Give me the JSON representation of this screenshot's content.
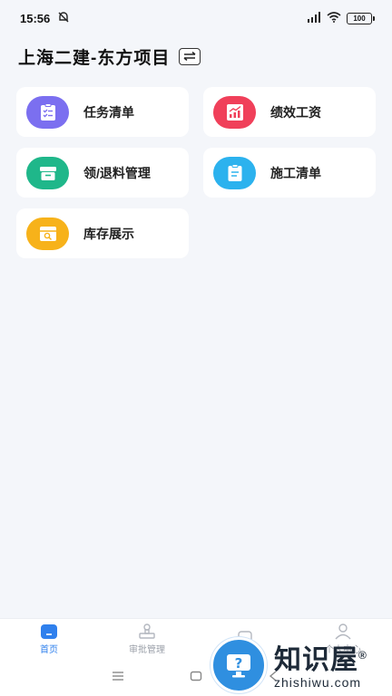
{
  "status_bar": {
    "time": "15:56",
    "battery": "100"
  },
  "header": {
    "project_title": "上海二建-东方项目"
  },
  "menu": [
    {
      "label": "任务清单",
      "icon": "task-list-icon",
      "color": "#7b6ff0"
    },
    {
      "label": "绩效工资",
      "icon": "performance-chart-icon",
      "color": "#f0405a"
    },
    {
      "label": "领/退料管理",
      "icon": "material-box-icon",
      "color": "#1fb78a"
    },
    {
      "label": "施工清单",
      "icon": "clipboard-icon",
      "color": "#2cb2ee"
    },
    {
      "label": "库存展示",
      "icon": "inventory-icon",
      "color": "#f7b21a"
    }
  ],
  "tabbar": [
    {
      "label": "首页",
      "active": true
    },
    {
      "label": "审批管理",
      "active": false
    },
    {
      "label": "",
      "active": false
    },
    {
      "label": "个人中心",
      "active": false
    }
  ],
  "watermark": {
    "main": "知识屋",
    "sub": "zhishiwu.com",
    "mark": "®"
  },
  "colors": {
    "accent": "#2f80ed",
    "background": "#f4f6fa"
  }
}
